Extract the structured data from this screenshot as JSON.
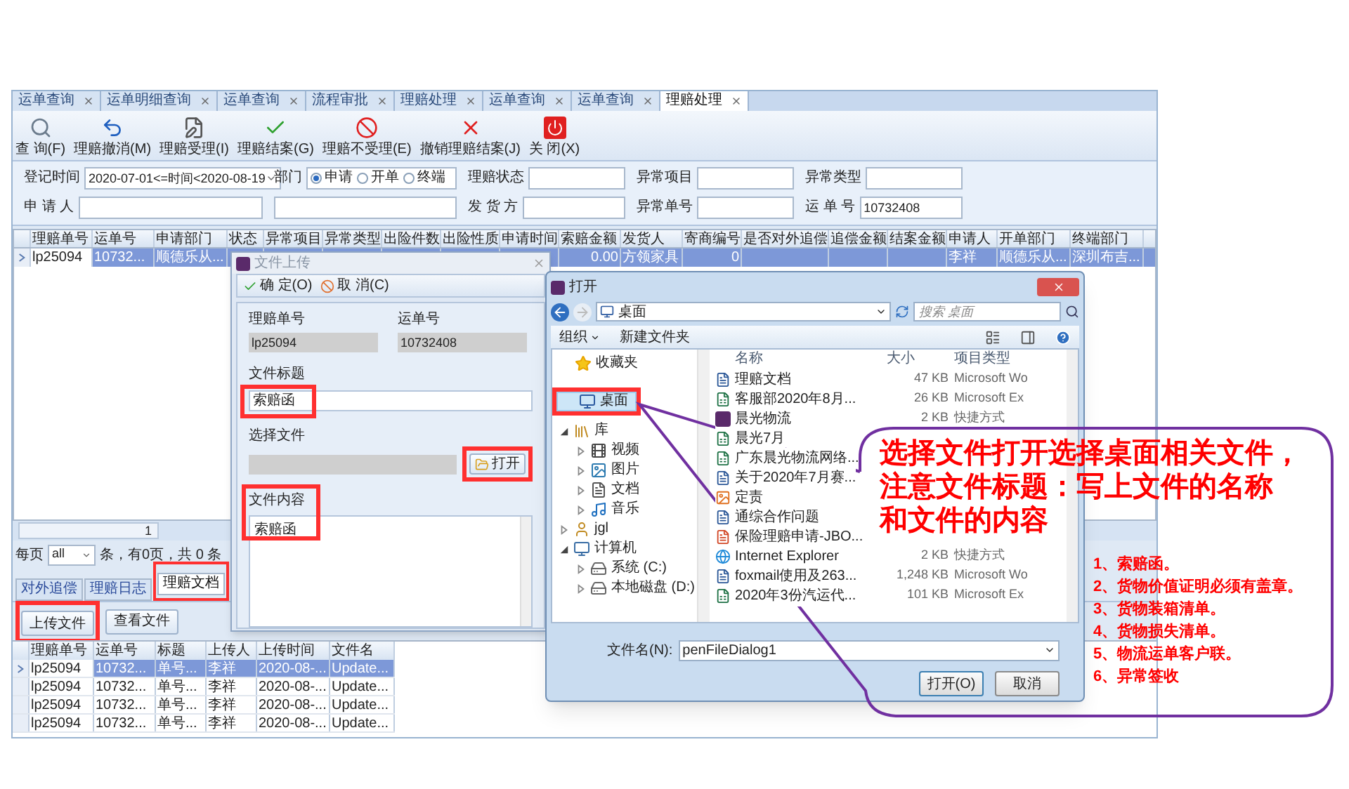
{
  "tabs": [
    {
      "label": "运单查询",
      "selected": false
    },
    {
      "label": "运单明细查询",
      "selected": false
    },
    {
      "label": "运单查询",
      "selected": false
    },
    {
      "label": "流程审批",
      "selected": false
    },
    {
      "label": "理赔处理",
      "selected": false
    },
    {
      "label": "运单查询",
      "selected": false
    },
    {
      "label": "运单查询",
      "selected": false
    },
    {
      "label": "理赔处理",
      "selected": true
    }
  ],
  "toolbar": [
    {
      "label": "查 询(F)",
      "kind": "search"
    },
    {
      "label": "理赔撤消(M)",
      "kind": "undo"
    },
    {
      "label": "理赔受理(I)",
      "kind": "edit"
    },
    {
      "label": "理赔结案(G)",
      "kind": "check"
    },
    {
      "label": "理赔不受理(E)",
      "kind": "ban"
    },
    {
      "label": "撤销理赔结案(J)",
      "kind": "cross"
    },
    {
      "label": "关 闭(X)",
      "kind": "power"
    }
  ],
  "filter": {
    "date_label": "登记时间",
    "date_value": "2020-07-01<=时间<2020-08-19",
    "dept_label": "部门",
    "dept_options": [
      {
        "label": "申请",
        "selected": true
      },
      {
        "label": "开单",
        "selected": false
      },
      {
        "label": "终端",
        "selected": false
      }
    ],
    "applicant_label": "申 请 人",
    "fields": [
      {
        "label": "理赔状态"
      },
      {
        "label": "异常项目"
      },
      {
        "label": "异常类型"
      },
      {
        "label": "发 货 方"
      },
      {
        "label": "异常单号"
      },
      {
        "label": "运 单 号",
        "value": "10732408"
      }
    ]
  },
  "main_table": {
    "columns": [
      "理赔单号",
      "运单号",
      "申请部门",
      "状态",
      "异常项目",
      "异常类型",
      "出险件数",
      "出险性质",
      "申请时间",
      "索赔金额",
      "发货人",
      "寄商编号",
      "是否对外追偿",
      "追偿金额",
      "结案金额",
      "申请人",
      "开单部门",
      "终端部门"
    ],
    "rows": [
      {
        "selected": true,
        "cells": [
          "lp25094",
          "10732...",
          "顺德乐从...",
          null,
          null,
          null,
          null,
          null,
          null,
          "0.00",
          "方领家具",
          "0",
          null,
          null,
          null,
          "李祥",
          "顺德乐从...",
          "深圳布吉..."
        ]
      }
    ]
  },
  "pager": {
    "page": "1",
    "per_page_label": "每页",
    "per_page_value": "all",
    "summary": "条，有0页，共 0 条"
  },
  "lower_tabs": [
    {
      "label": "对外追偿",
      "selected": false
    },
    {
      "label": "理赔日志",
      "selected": false
    },
    {
      "label": "理赔文档",
      "selected": true
    }
  ],
  "doc_buttons": [
    "上传文件",
    "查看文件"
  ],
  "doc_table": {
    "columns": [
      "理赔单号",
      "运单号",
      "标题",
      "上传人",
      "上传时间",
      "文件名"
    ],
    "rows": [
      {
        "selected": true,
        "cells": [
          "lp25094",
          "10732...",
          "单号...",
          "李祥",
          "2020-08-...",
          "Update..."
        ]
      },
      {
        "selected": false,
        "cells": [
          "lp25094",
          "10732...",
          "单号...",
          "李祥",
          "2020-08-...",
          "Update..."
        ]
      },
      {
        "selected": false,
        "cells": [
          "lp25094",
          "10732...",
          "单号...",
          "李祥",
          "2020-08-...",
          "Update..."
        ]
      },
      {
        "selected": false,
        "cells": [
          "lp25094",
          "10732...",
          "单号...",
          "李祥",
          "2020-08-...",
          "Update..."
        ]
      }
    ]
  },
  "upload_dialog": {
    "title": "文件上传",
    "buttons": [
      {
        "label": "确 定(O)",
        "kind": "ok"
      },
      {
        "label": "取 消(C)",
        "kind": "cancel"
      }
    ],
    "claim_no": {
      "label": "理赔单号",
      "value": "lp25094"
    },
    "waybill": {
      "label": "运单号",
      "value": "10732408"
    },
    "file_title": {
      "label": "文件标题",
      "value": "索赔函"
    },
    "file_label": "选择文件",
    "open_button": "打开",
    "content": {
      "label": "文件内容",
      "value": "索赔函"
    }
  },
  "open_dialog": {
    "title": "打开",
    "path": "桌面",
    "search_placeholder": "搜索 桌面",
    "organize": "组织",
    "new_folder": "新建文件夹",
    "nav": [
      {
        "label": "收藏夹",
        "kind": "star",
        "selected": false
      },
      {
        "label": "桌面",
        "kind": "desktop",
        "selected": true
      },
      {
        "label": "库",
        "kind": "library",
        "selected": false,
        "expanded": true,
        "children": [
          {
            "label": "视频",
            "kind": "video",
            "selected": false,
            "expanded": false
          },
          {
            "label": "图片",
            "kind": "picture",
            "selected": false,
            "expanded": false
          },
          {
            "label": "文档",
            "kind": "document",
            "selected": false,
            "expanded": false
          },
          {
            "label": "音乐",
            "kind": "music",
            "selected": false,
            "expanded": false
          }
        ]
      },
      {
        "label": "jgl",
        "kind": "user",
        "selected": false,
        "expanded": false
      },
      {
        "label": "计算机",
        "kind": "computer",
        "selected": false,
        "expanded": true,
        "children": [
          {
            "label": "系统 (C:)",
            "kind": "drive",
            "selected": false,
            "expanded": false
          },
          {
            "label": "本地磁盘 (D:)",
            "kind": "drive",
            "selected": false,
            "expanded": false
          }
        ]
      }
    ],
    "columns": [
      "名称",
      "大小",
      "项目类型"
    ],
    "files": [
      {
        "name": "理赔文档",
        "kind": "word",
        "size": "47 KB",
        "type": "Microsoft Wo"
      },
      {
        "name": "客服部2020年8月...",
        "kind": "excel",
        "size": "26 KB",
        "type": "Microsoft Ex"
      },
      {
        "name": "晨光物流",
        "kind": "shortcut",
        "size": "2 KB",
        "type": "快捷方式"
      },
      {
        "name": "晨光7月",
        "kind": "excel"
      },
      {
        "name": "广东晨光物流网络...",
        "kind": "excel"
      },
      {
        "name": "关于2020年7月赛...",
        "kind": "word"
      },
      {
        "name": "定责",
        "kind": "png"
      },
      {
        "name": "通综合作问题",
        "kind": "word"
      },
      {
        "name": "保险理赔申请-JBO...",
        "kind": "ppt"
      },
      {
        "name": "Internet Explorer",
        "kind": "ie",
        "size": "2 KB",
        "type": "快捷方式"
      },
      {
        "name": "foxmail使用及263...",
        "kind": "word",
        "size": "1,248 KB",
        "type": "Microsoft Wo"
      },
      {
        "name": "2020年3份汽运代...",
        "kind": "excel",
        "size": "101 KB",
        "type": "Microsoft Ex"
      }
    ],
    "filename_label": "文件名(N):",
    "filename_value": "penFileDialog1",
    "buttons": [
      "打开(O)",
      "取消"
    ]
  },
  "callout": {
    "heading": [
      "选择文件打开选择桌面相关文件，",
      "注意文件标题：写上文件的名称",
      "和文件的内容"
    ],
    "list": [
      "1、索赔函。",
      "2、货物价值证明必须有盖章。",
      "3、货物装箱清单。",
      "4、货物损失清单。",
      "5、物流运单客户联。",
      "6、异常签收"
    ]
  }
}
